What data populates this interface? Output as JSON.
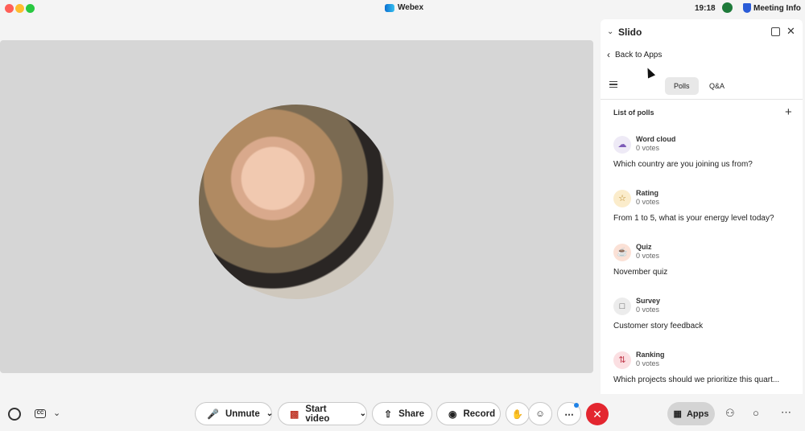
{
  "titlebar": {
    "app_name": "Webex",
    "time": "19:18",
    "meeting_info": "Meeting Info"
  },
  "panel": {
    "title": "Slido",
    "back_label": "Back to Apps",
    "tabs": [
      "Polls",
      "Q&A"
    ],
    "list_title": "List of polls",
    "polls": [
      {
        "type": "Word cloud",
        "votes": "0 votes",
        "question": "Which country are you joining us from?",
        "icon": "cloud-icon"
      },
      {
        "type": "Rating",
        "votes": "0 votes",
        "question": "From 1 to 5, what is your energy level today?",
        "icon": "star-icon"
      },
      {
        "type": "Quiz",
        "votes": "0 votes",
        "question": "November quiz",
        "icon": "trophy-icon"
      },
      {
        "type": "Survey",
        "votes": "0 votes",
        "question": "Customer story feedback",
        "icon": "folder-icon"
      },
      {
        "type": "Ranking",
        "votes": "0 votes",
        "question": "Which projects should we prioritize this quart...",
        "icon": "ranking-icon"
      }
    ]
  },
  "toolbar": {
    "unmute_label": "Unmute",
    "video_label": "Start video",
    "share_label": "Share",
    "record_label": "Record",
    "apps_label": "Apps",
    "cc_label": "CC"
  },
  "colors": {
    "end_call": "#e3262f",
    "accent": "#1f82e6"
  }
}
